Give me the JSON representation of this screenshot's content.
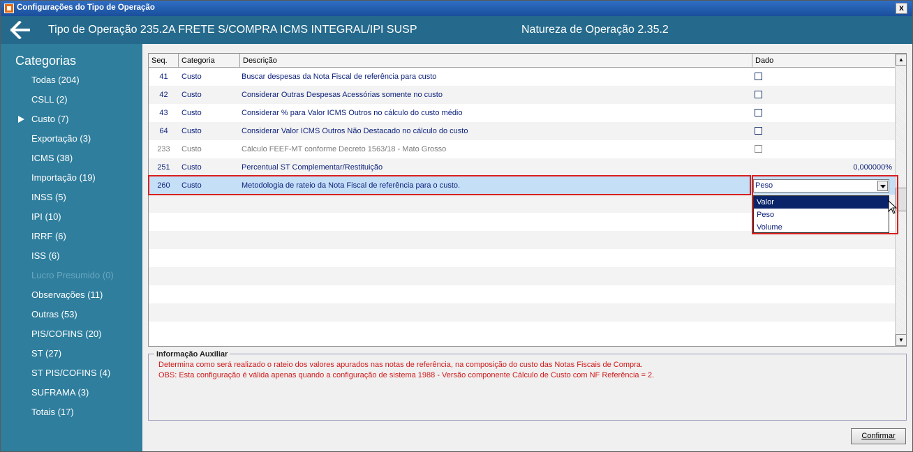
{
  "window": {
    "title": "Configurações do Tipo de Operação",
    "close_glyph": "x"
  },
  "header": {
    "operation_title": "Tipo de Operação 235.2A  FRETE S/COMPRA ICMS INTEGRAL/IPI SUSP",
    "natureza": "Natureza de Operação 2.35.2"
  },
  "sidebar": {
    "title": "Categorias",
    "selected_index": 2,
    "items": [
      {
        "label": "Todas (204)",
        "enabled": true
      },
      {
        "label": "CSLL (2)",
        "enabled": true
      },
      {
        "label": "Custo (7)",
        "enabled": true
      },
      {
        "label": "Exportação (3)",
        "enabled": true
      },
      {
        "label": "ICMS (38)",
        "enabled": true
      },
      {
        "label": "Importação (19)",
        "enabled": true
      },
      {
        "label": "INSS (5)",
        "enabled": true
      },
      {
        "label": "IPI (10)",
        "enabled": true
      },
      {
        "label": "IRRF (6)",
        "enabled": true
      },
      {
        "label": "ISS (6)",
        "enabled": true
      },
      {
        "label": "Lucro Presumido (0)",
        "enabled": false
      },
      {
        "label": "Observações (11)",
        "enabled": true
      },
      {
        "label": "Outras (53)",
        "enabled": true
      },
      {
        "label": "PIS/COFINS (20)",
        "enabled": true
      },
      {
        "label": "ST (27)",
        "enabled": true
      },
      {
        "label": "ST PIS/COFINS (4)",
        "enabled": true
      },
      {
        "label": "SUFRAMA (3)",
        "enabled": true
      },
      {
        "label": "Totais (17)",
        "enabled": true
      }
    ]
  },
  "grid": {
    "columns": [
      "Seq.",
      "Categoria",
      "Descrição",
      "Dado"
    ],
    "rows": [
      {
        "seq": "41",
        "categoria": "Custo",
        "descricao": "Buscar despesas da Nota Fiscal de referência para custo",
        "dado_type": "checkbox",
        "dado": ""
      },
      {
        "seq": "42",
        "categoria": "Custo",
        "descricao": "Considerar Outras Despesas Acessórias somente no custo",
        "dado_type": "checkbox",
        "dado": ""
      },
      {
        "seq": "43",
        "categoria": "Custo",
        "descricao": "Considerar % para Valor ICMS Outros no cálculo do custo médio",
        "dado_type": "checkbox",
        "dado": ""
      },
      {
        "seq": "64",
        "categoria": "Custo",
        "descricao": "Considerar Valor ICMS Outros Não Destacado no cálculo do custo",
        "dado_type": "checkbox",
        "dado": ""
      },
      {
        "seq": "233",
        "categoria": "Custo",
        "descricao": "Cálculo FEEF-MT conforme Decreto 1563/18 - Mato Grosso",
        "dado_type": "checkbox",
        "dado": "",
        "disabled": true
      },
      {
        "seq": "251",
        "categoria": "Custo",
        "descricao": "Percentual ST Complementar/Restituição",
        "dado_type": "text",
        "dado": "0,000000%"
      },
      {
        "seq": "260",
        "categoria": "Custo",
        "descricao": "Metodologia de rateio da Nota Fiscal de referência para o custo.",
        "dado_type": "combo",
        "dado": "Peso",
        "selected": true
      }
    ],
    "combo_options": [
      "Valor",
      "Peso",
      "Volume"
    ],
    "combo_highlighted": "Valor"
  },
  "info": {
    "legend": "Informação Auxiliar",
    "line1": "Determina como será realizado o rateio dos valores apurados nas notas de referência, na composição do custo das Notas Fiscais de Compra.",
    "line2": "OBS: Esta configuração é válida apenas quando a configuração de sistema 1988 - Versão componente Cálculo de Custo com NF Referência = 2."
  },
  "footer": {
    "confirm_label": "Confirmar"
  },
  "colors": {
    "header_bg": "#256a8c",
    "sidebar_bg": "#2f7e9d",
    "highlight_border": "#d9211f",
    "info_text": "#d11a1a"
  }
}
